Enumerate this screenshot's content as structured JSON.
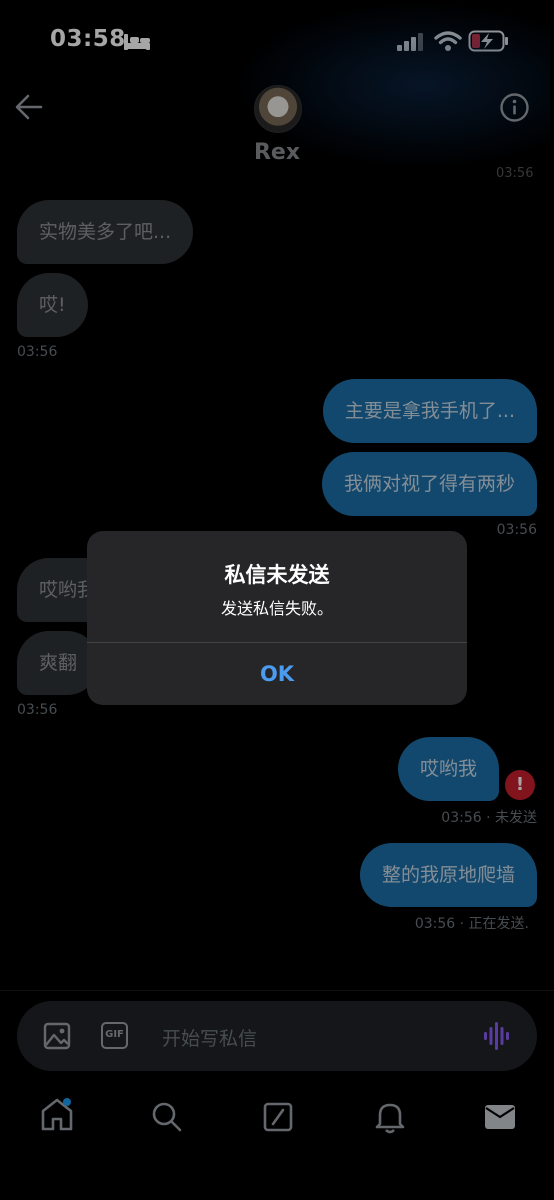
{
  "status_bar": {
    "time": "03:58"
  },
  "header": {
    "contact_name": "Rex",
    "cut_timestamp": "03:56"
  },
  "messages": {
    "m1": "实物美多了吧...",
    "m2": "哎!",
    "m2_time": "03:56",
    "m3": "主要是拿我手机了...",
    "m4": "我俩对视了得有两秒",
    "m4_time": "03:56",
    "m5": "哎哟我",
    "m6": "爽翻",
    "m6_time": "03:56",
    "m7": "哎哟我",
    "m7_status": "03:56 · 未发送",
    "m8": "整的我原地爬墙",
    "m8_status": "03:56 · 正在发送."
  },
  "alert": {
    "title": "私信未发送",
    "message": "发送私信失败。",
    "ok_label": "OK"
  },
  "composer": {
    "placeholder": "开始写私信",
    "gif_label": "GIF"
  },
  "nav": {
    "items": [
      "home-icon",
      "search-icon",
      "grok-icon",
      "notifications-icon",
      "messages-icon"
    ]
  },
  "colors": {
    "accent": "#1d9bf0",
    "outgoing_bubble": "#1d6fa8",
    "incoming_bubble": "#2f3336",
    "error": "#c8202f",
    "voice": "#8b5cf6"
  }
}
